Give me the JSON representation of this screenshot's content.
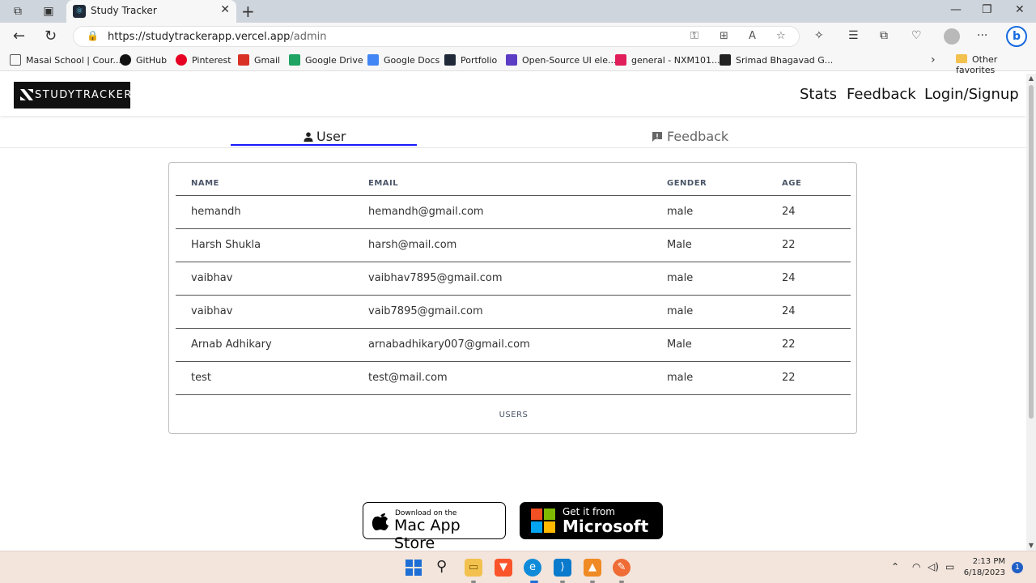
{
  "browser": {
    "tab_title": "Study Tracker",
    "url_main": "https://studytrackerapp.vercel.app",
    "url_path": "/admin",
    "bookmarks": [
      {
        "label": "Masai School | Cour...",
        "icon": "page-icon",
        "color": "#555555"
      },
      {
        "label": "GitHub",
        "icon": "github-icon",
        "color": "#111111"
      },
      {
        "label": "Pinterest",
        "icon": "pinterest-icon",
        "color": "#e60023"
      },
      {
        "label": "Gmail",
        "icon": "gmail-icon",
        "color": "#d93025"
      },
      {
        "label": "Google Drive",
        "icon": "drive-icon",
        "color": "#1fa463"
      },
      {
        "label": "Google Docs",
        "icon": "docs-icon",
        "color": "#4285f4"
      },
      {
        "label": "Portfolio",
        "icon": "react-icon",
        "color": "#1f2937"
      },
      {
        "label": "Open-Source UI ele...",
        "icon": "ui-icon",
        "color": "#5b3cc4"
      },
      {
        "label": "general - NXM101...",
        "icon": "slack-icon",
        "color": "#e01e5a"
      },
      {
        "label": "Srimad Bhagavad G...",
        "icon": "temple-icon",
        "color": "#222222"
      }
    ],
    "other_favorites": "Other favorites"
  },
  "site": {
    "logo_text": "STUDYTRACKER",
    "nav": [
      "Stats",
      "Feedback",
      "Login/Signup"
    ],
    "tabs": [
      {
        "label": "User",
        "icon": "user-icon"
      },
      {
        "label": "Feedback",
        "icon": "feedback-icon"
      }
    ]
  },
  "table": {
    "headers": [
      "NAME",
      "EMAIL",
      "GENDER",
      "AGE"
    ],
    "rows": [
      [
        "hemandh",
        "hemandh@gmail.com",
        "male",
        "24"
      ],
      [
        "Harsh Shukla",
        "harsh@mail.com",
        "Male",
        "22"
      ],
      [
        "vaibhav",
        "vaibhav7895@gmail.com",
        "male",
        "24"
      ],
      [
        "vaibhav",
        "vaib7895@gmail.com",
        "male",
        "24"
      ],
      [
        "Arnab Adhikary",
        "arnabadhikary007@gmail.com",
        "Male",
        "22"
      ],
      [
        "test",
        "test@mail.com",
        "male",
        "22"
      ]
    ],
    "caption": "USERS"
  },
  "stores": {
    "apple_small": "Download on the",
    "apple_big": "Mac App Store",
    "ms_small": "Get it from",
    "ms_big": "Microsoft"
  },
  "taskbar": {
    "time": "2:13 PM",
    "date": "6/18/2023",
    "notifications": "1"
  }
}
